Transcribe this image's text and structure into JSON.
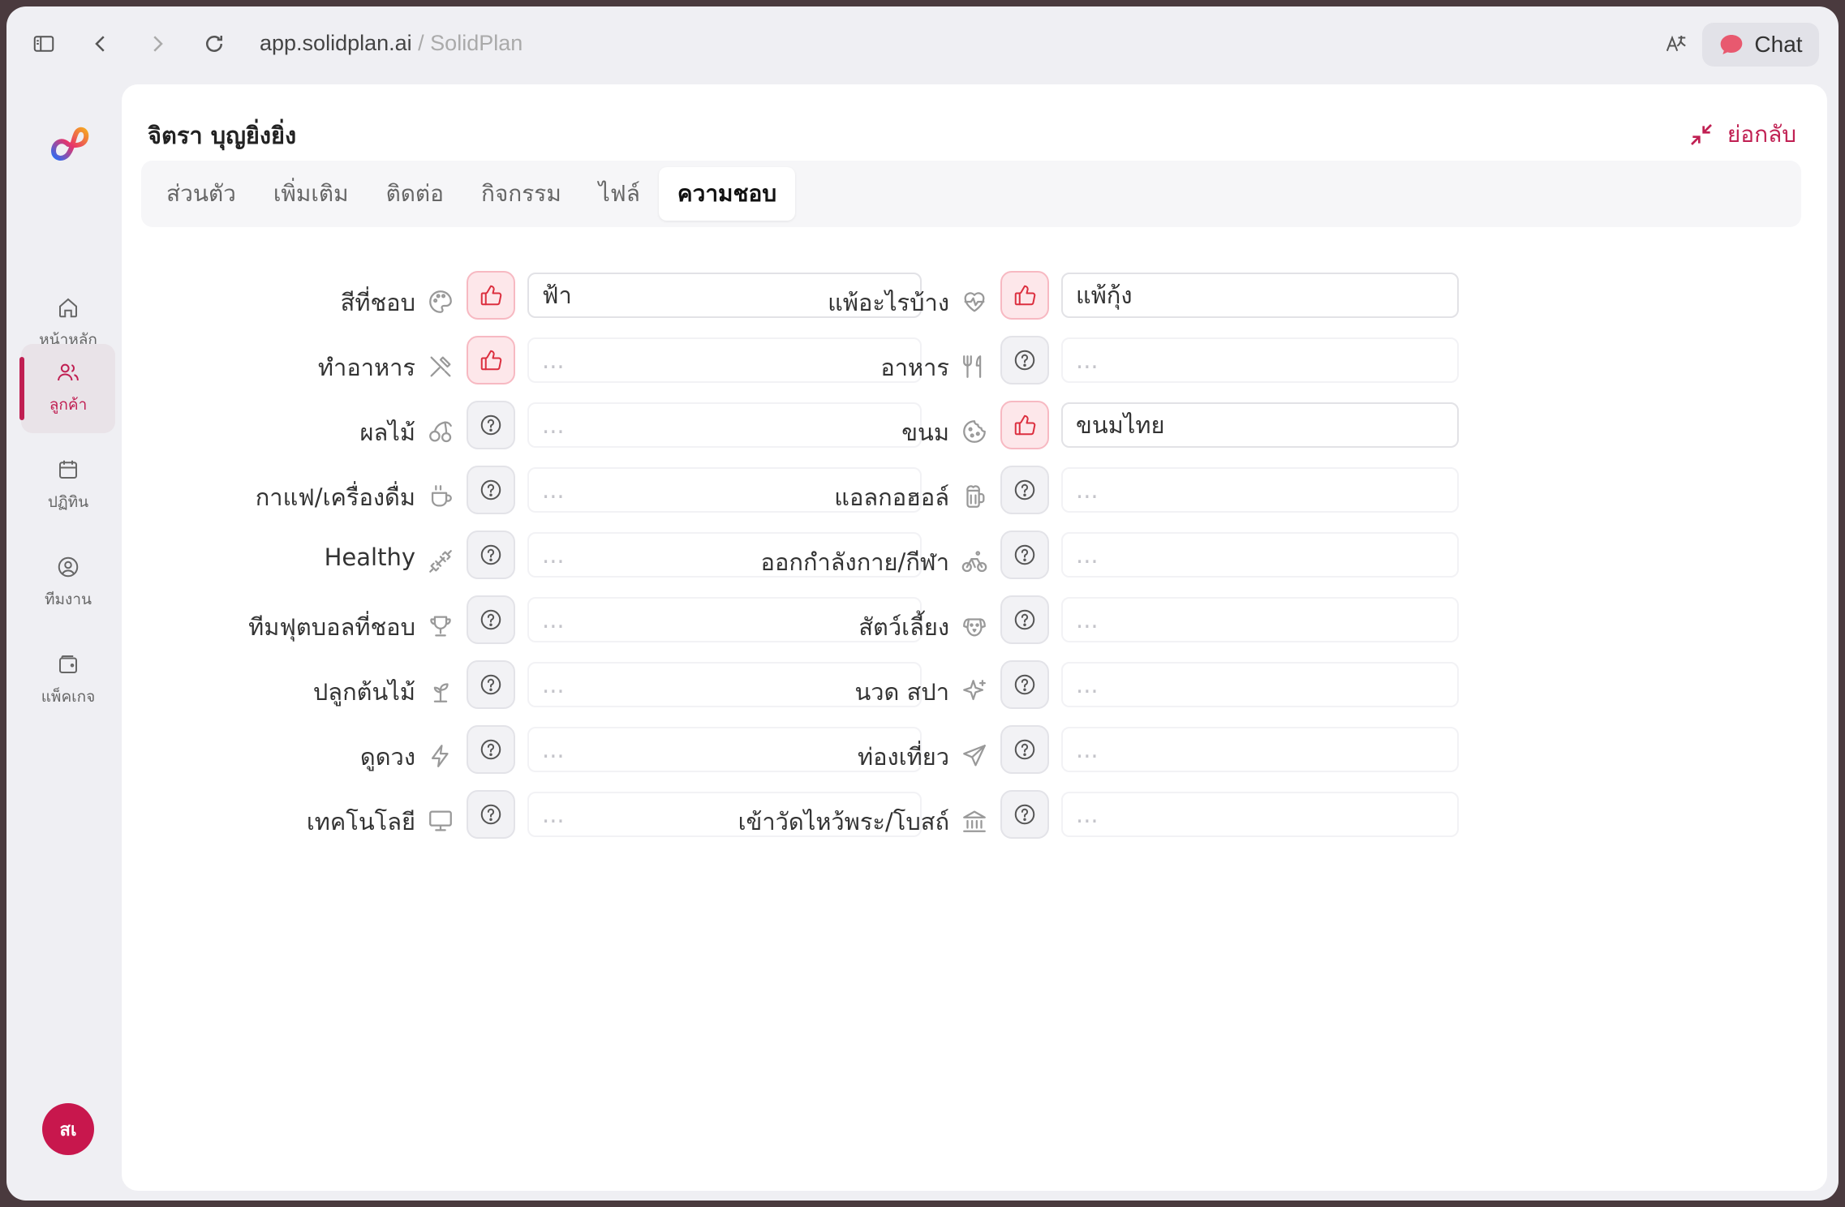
{
  "browser": {
    "url_domain": "app.solidplan.ai",
    "url_sep": " / ",
    "url_site": "SolidPlan",
    "chat_label": "Chat"
  },
  "nav": [
    {
      "label": "หน้าหลัก",
      "icon": "home-icon",
      "active": false
    },
    {
      "label": "ลูกค้า",
      "icon": "users-icon",
      "active": true
    },
    {
      "label": "ปฏิทิน",
      "icon": "calendar-icon",
      "active": false
    },
    {
      "label": "ทีมงาน",
      "icon": "user-circle-icon",
      "active": false
    },
    {
      "label": "แพ็คเกจ",
      "icon": "wallet-icon",
      "active": false
    }
  ],
  "avatar_initials": "สเ",
  "customer": {
    "name": "จิตรา บุญยิ่งยิ่ง",
    "collapse_label": "ย่อกลับ"
  },
  "tabs": [
    {
      "label": "ส่วนตัว",
      "active": false
    },
    {
      "label": "เพิ่มเติม",
      "active": false
    },
    {
      "label": "ติดต่อ",
      "active": false
    },
    {
      "label": "กิจกรรม",
      "active": false
    },
    {
      "label": "ไฟล์",
      "active": false
    },
    {
      "label": "ความชอบ",
      "active": true
    }
  ],
  "placeholder": "...",
  "preferences_left": [
    {
      "label": "สีที่ชอบ",
      "icon": "palette-icon",
      "status": "like",
      "value": "ฟ้า"
    },
    {
      "label": "ทำอาหาร",
      "icon": "utensils-crossed-icon",
      "status": "like",
      "value": ""
    },
    {
      "label": "ผลไม้",
      "icon": "cherry-icon",
      "status": "unknown",
      "value": ""
    },
    {
      "label": "กาแฟ/เครื่องดื่ม",
      "icon": "coffee-icon",
      "status": "unknown",
      "value": ""
    },
    {
      "label": "Healthy",
      "icon": "dumbbell-icon",
      "status": "unknown",
      "value": ""
    },
    {
      "label": "ทีมฟุตบอลที่ชอบ",
      "icon": "trophy-icon",
      "status": "unknown",
      "value": ""
    },
    {
      "label": "ปลูกต้นไม้",
      "icon": "sprout-icon",
      "status": "unknown",
      "value": ""
    },
    {
      "label": "ดูดวง",
      "icon": "zap-icon",
      "status": "unknown",
      "value": ""
    },
    {
      "label": "เทคโนโลยี",
      "icon": "monitor-icon",
      "status": "unknown",
      "value": ""
    }
  ],
  "preferences_right": [
    {
      "label": "แพ้อะไรบ้าง",
      "icon": "heart-pulse-icon",
      "status": "like",
      "value": "แพ้กุ้ง"
    },
    {
      "label": "อาหาร",
      "icon": "fork-knife-icon",
      "status": "unknown",
      "value": ""
    },
    {
      "label": "ขนม",
      "icon": "cookie-icon",
      "status": "like",
      "value": "ขนมไทย"
    },
    {
      "label": "แอลกอฮอล์",
      "icon": "beer-icon",
      "status": "unknown",
      "value": ""
    },
    {
      "label": "ออกกำลังกาย/กีฬา",
      "icon": "bike-icon",
      "status": "unknown",
      "value": ""
    },
    {
      "label": "สัตว์เลี้ยง",
      "icon": "dog-icon",
      "status": "unknown",
      "value": ""
    },
    {
      "label": "นวด สปา",
      "icon": "sparkles-icon",
      "status": "unknown",
      "value": ""
    },
    {
      "label": "ท่องเที่ยว",
      "icon": "plane-icon",
      "status": "unknown",
      "value": ""
    },
    {
      "label": "เข้าวัดไหว้พระ/โบสถ์",
      "icon": "landmark-icon",
      "status": "unknown",
      "value": ""
    }
  ],
  "colors": {
    "accent": "#c01f52",
    "like_bg": "#fde7ea",
    "like_icon": "#dc2f3f"
  }
}
